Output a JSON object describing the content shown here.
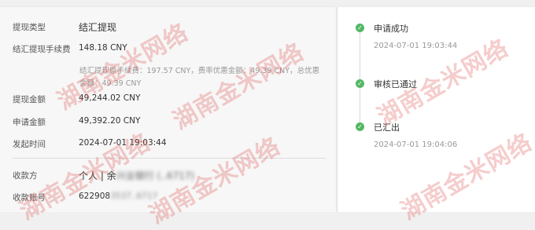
{
  "details": {
    "withdraw_type": {
      "label": "提现类型",
      "value": "结汇提现"
    },
    "fee": {
      "label": "结汇提现手续费",
      "value": "148.18 CNY"
    },
    "fee_note": {
      "line1": "结汇提现原手续费：197.57 CNY，费率优惠金额：49.39 CNY，总优惠",
      "line2": "金额：49.39 CNY"
    },
    "withdraw_amount": {
      "label": "提现金额",
      "value": "49,244.02 CNY"
    },
    "apply_amount": {
      "label": "申请金额",
      "value": "49,392.20 CNY"
    },
    "initiated_time": {
      "label": "发起时间",
      "value": "2024-07-01 19:03:44"
    },
    "payee": {
      "label": "收款方",
      "value": "个人 | 余",
      "masked": "兴业银行 (..6717)"
    },
    "payee_account": {
      "label": "收款账号",
      "value": "622908",
      "masked": "3537..6717"
    }
  },
  "timeline": [
    {
      "title": "申请成功",
      "time": "2024-07-01 19:03:44",
      "status": "done"
    },
    {
      "title": "审核已通过",
      "time": "",
      "status": "done"
    },
    {
      "title": "已汇出",
      "time": "2024-07-01 19:04:06",
      "status": "done"
    }
  ],
  "watermark": {
    "text": "湖南金米网络"
  },
  "colors": {
    "success_green": "#53b865",
    "watermark_red": "#e1645f"
  },
  "icons": {
    "status": "check-circle-icon"
  }
}
